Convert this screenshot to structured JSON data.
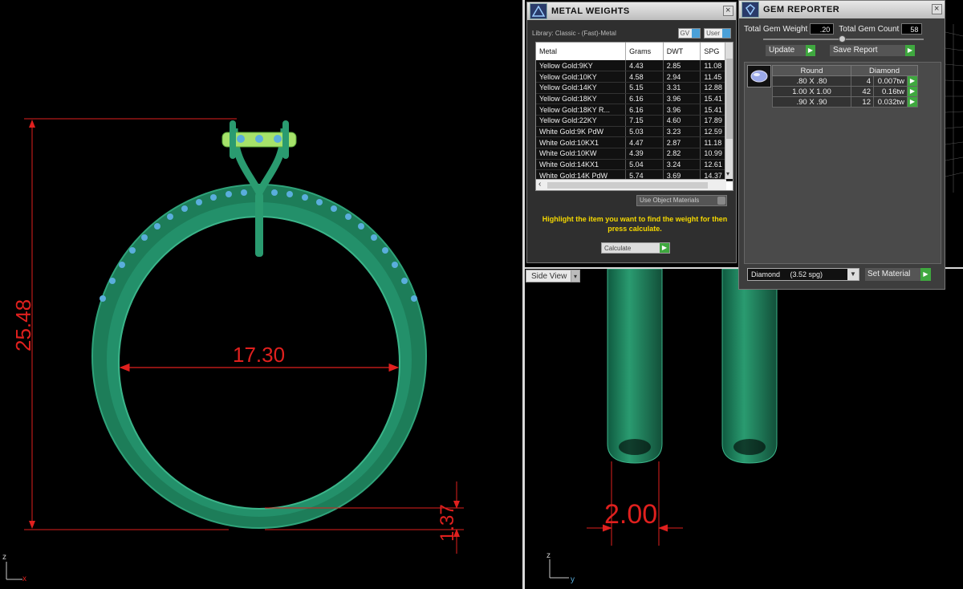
{
  "viewports": {
    "front": {
      "dimensions": {
        "height": "25.48",
        "inner_diameter": "17.30",
        "shank_thickness": "1.37"
      },
      "axes": {
        "vertical": "z",
        "horizontal": "x"
      }
    },
    "side": {
      "label": "Side View",
      "dimensions": {
        "width": "2.00"
      },
      "axes": {
        "vertical": "z",
        "horizontal": "y"
      }
    }
  },
  "metal_weights": {
    "title": "METAL WEIGHTS",
    "library": "Library: Classic - (Fast)-Metal",
    "toggle_gv": "GV",
    "toggle_user": "User",
    "columns": [
      "Metal",
      "Grams",
      "DWT",
      "SPG"
    ],
    "rows": [
      [
        "Yellow Gold:9KY",
        "4.43",
        "2.85",
        "11.08"
      ],
      [
        "Yellow Gold:10KY",
        "4.58",
        "2.94",
        "11.45"
      ],
      [
        "Yellow Gold:14KY",
        "5.15",
        "3.31",
        "12.88"
      ],
      [
        "Yellow Gold:18KY",
        "6.16",
        "3.96",
        "15.41"
      ],
      [
        "Yellow Gold:18KY R...",
        "6.16",
        "3.96",
        "15.41"
      ],
      [
        "Yellow Gold:22KY",
        "7.15",
        "4.60",
        "17.89"
      ],
      [
        "White Gold:9K PdW",
        "5.03",
        "3.23",
        "12.59"
      ],
      [
        "White Gold:10KX1",
        "4.47",
        "2.87",
        "11.18"
      ],
      [
        "White Gold:10KW",
        "4.39",
        "2.82",
        "10.99"
      ],
      [
        "White Gold:14KX1",
        "5.04",
        "3.24",
        "12.61"
      ],
      [
        "White Gold:14K PdW",
        "5.74",
        "3.69",
        "14.37"
      ]
    ],
    "use_object_materials": "Use Object Materials",
    "hint": "Highlight the item you want to find the weight for then press calculate.",
    "calculate_label": "Calculate"
  },
  "gem_reporter": {
    "title": "GEM REPORTER",
    "total_weight_label": "Total Gem Weight",
    "total_weight_value": ".20",
    "total_count_label": "Total Gem Count",
    "total_count_value": "58",
    "update_label": "Update",
    "save_report_label": "Save Report",
    "shape_header": "Round",
    "material_header": "Diamond",
    "gems": [
      {
        "size": ".80 X .80",
        "count": "4",
        "weight": "0.007tw"
      },
      {
        "size": "1.00 X 1.00",
        "count": "42",
        "weight": "0.16tw"
      },
      {
        "size": ".90 X .90",
        "count": "12",
        "weight": "0.032tw"
      }
    ],
    "material_select": "Diamond     (3.52 spg)",
    "set_material_label": "Set Material"
  },
  "colors": {
    "dimension": "#e0201e",
    "ring_body": "#1f8a63",
    "gem": "#5aaedc",
    "head": "#a6e26a",
    "hint_text": "#f5d800",
    "go_button": "#3fa83f"
  }
}
